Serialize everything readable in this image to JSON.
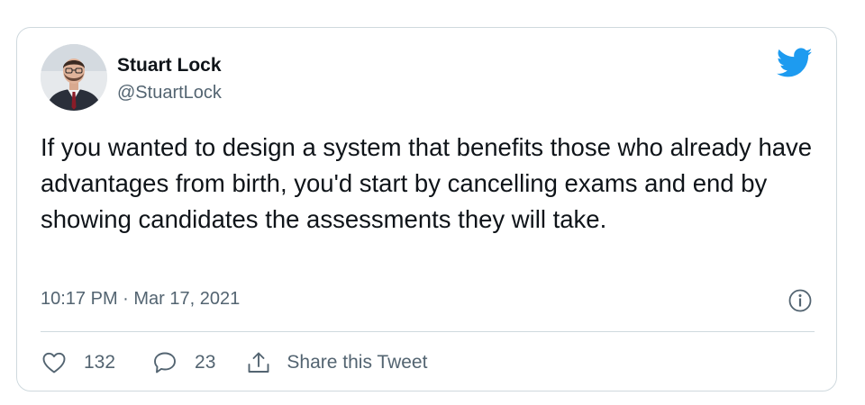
{
  "tweet": {
    "author_name": "Stuart Lock",
    "author_handle": "@StuartLock",
    "text": "If you wanted to design a system that benefits those who already have advantages from birth, you'd start by cancelling exams and end by showing candidates the assessments they will take.",
    "timestamp": "10:17 PM · Mar 17, 2021",
    "like_count": "132",
    "reply_count": "23",
    "share_label": "Share this Tweet"
  },
  "icons": {
    "brand": "twitter-bird-icon",
    "info": "info-icon",
    "like": "heart-icon",
    "reply": "speech-bubble-icon",
    "share": "share-upload-icon"
  },
  "colors": {
    "brand": "#1d9bf0",
    "text": "#0f1419",
    "secondary_text": "#536471",
    "border": "#cfd9de"
  }
}
